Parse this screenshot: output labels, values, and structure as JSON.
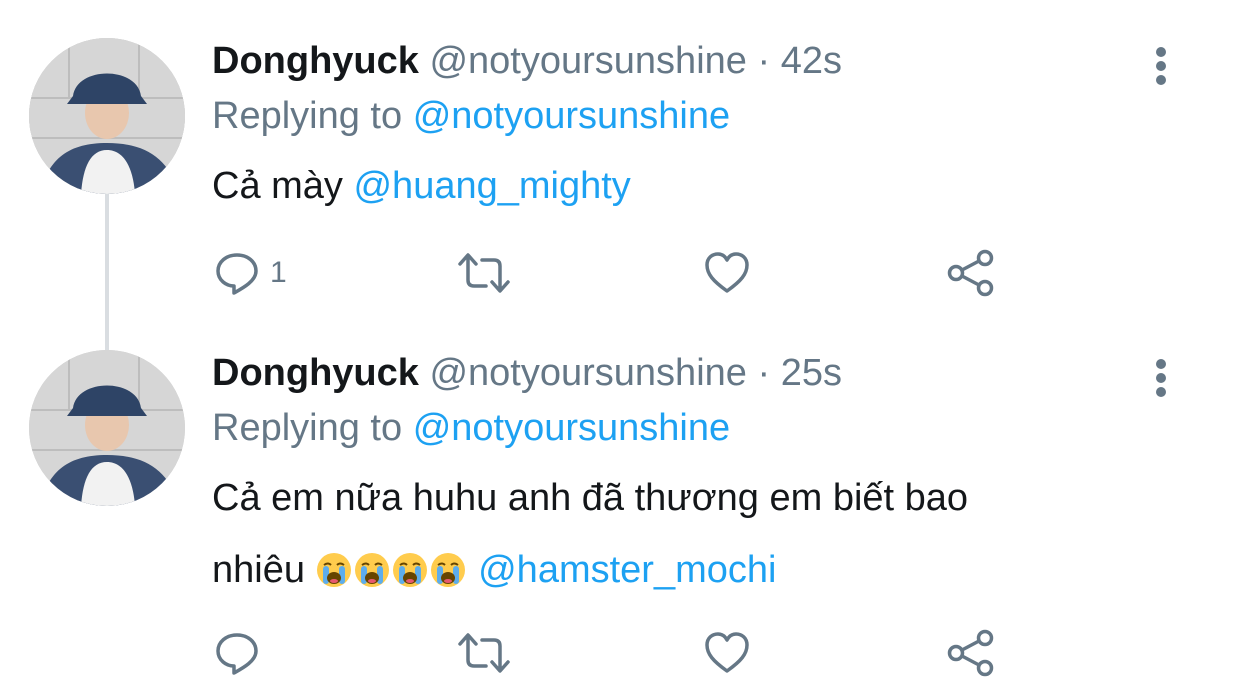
{
  "tweets": [
    {
      "author_name": "Donghyuck",
      "handle": "@notyoursunshine",
      "separator": "·",
      "time": "42s",
      "replying_prefix": "Replying to",
      "replying_to": "@notyoursunshine",
      "text": "Cả mày",
      "mention": "@huang_mighty",
      "reply_count": "1"
    },
    {
      "author_name": "Donghyuck",
      "handle": "@notyoursunshine",
      "separator": "·",
      "time": "25s",
      "replying_prefix": "Replying to",
      "replying_to": "@notyoursunshine",
      "text_line1": "Cả em nữa huhu anh đã thương em biết bao",
      "text_line2": "nhiêu",
      "emojis": [
        "loudly-crying-face",
        "loudly-crying-face",
        "loudly-crying-face",
        "loudly-crying-face"
      ],
      "mention": "@hamster_mochi",
      "reply_count": ""
    }
  ],
  "icons": {
    "reply": "reply-icon",
    "retweet": "retweet-icon",
    "like": "heart-icon",
    "share": "share-icon",
    "more": "more-vertical-icon"
  },
  "colors": {
    "text": "#14171a",
    "secondary": "#657786",
    "link": "#1da1f2",
    "thread_line": "#d9dde1"
  }
}
